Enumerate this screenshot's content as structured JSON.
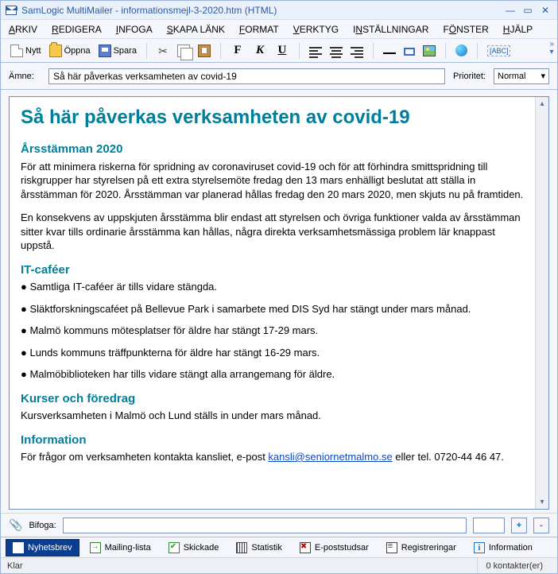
{
  "title": "SamLogic MultiMailer - informationsmejl-3-2020.htm  (HTML)",
  "menu": [
    "ARKIV",
    "REDIGERA",
    "INFOGA",
    "SKAPA LÄNK",
    "FORMAT",
    "VERKTYG",
    "INSTÄLLNINGAR",
    "FÖNSTER",
    "HJÄLP"
  ],
  "toolbar": {
    "new": "Nytt",
    "open": "Öppna",
    "save": "Spara",
    "abc": "[ABC]"
  },
  "subject": {
    "label": "Ämne:",
    "value": "Så här påverkas verksamheten av covid-19",
    "priority_label": "Prioritet:",
    "priority_value": "Normal"
  },
  "body": {
    "h1": "Så här påverkas verksamheten av covid-19",
    "s1_h": "Årsstämman 2020",
    "s1_p1": "För att minimera riskerna för spridning av coronaviruset covid-19 och för att förhindra smittspridning till riskgrupper har styrelsen på ett extra styrelsemöte fredag den 13 mars enhälligt beslutat att ställa in årsstämman för 2020. Årsstämman var planerad hållas fredag den 20 mars 2020, men skjuts nu på framtiden.",
    "s1_p2": "En konsekvens av uppskjuten årsstämma blir endast att styrelsen och övriga funktioner valda av årsstämman sitter kvar tills ordinarie årsstämma kan hållas, några direkta verksamhetsmässiga problem lär knappast uppstå.",
    "s2_h": "IT-caféer",
    "s2_b1": "● Samtliga IT-caféer är tills vidare stängda.",
    "s2_b2": "● Släktforskningscaféet på Bellevue Park i samarbete med DIS Syd har stängt under mars månad.",
    "s2_b3": "● Malmö kommuns mötesplatser för äldre har stängt 17-29 mars.",
    "s2_b4": "● Lunds kommuns träffpunkterna för äldre har stängt 16-29 mars.",
    "s2_b5": "● Malmöbiblioteken har tills vidare stängt alla arrangemang för äldre.",
    "s3_h": "Kurser och föredrag",
    "s3_p1": "Kursverksamheten i Malmö och Lund ställs in under mars månad.",
    "s4_h": "Information",
    "s4_pre": "För frågor om verksamheten kontakta kansliet, e-post ",
    "s4_link": "kansli@seniornetmalmo.se",
    "s4_post": " eller tel. 0720-44 46 47."
  },
  "attach": {
    "label": "Bifoga:"
  },
  "tabs": [
    "Nyhetsbrev",
    "Mailing-lista",
    "Skickade",
    "Statistik",
    "E-poststudsar",
    "Registreringar",
    "Information"
  ],
  "status": {
    "left": "Klar",
    "right": "0 kontakter(er)"
  }
}
